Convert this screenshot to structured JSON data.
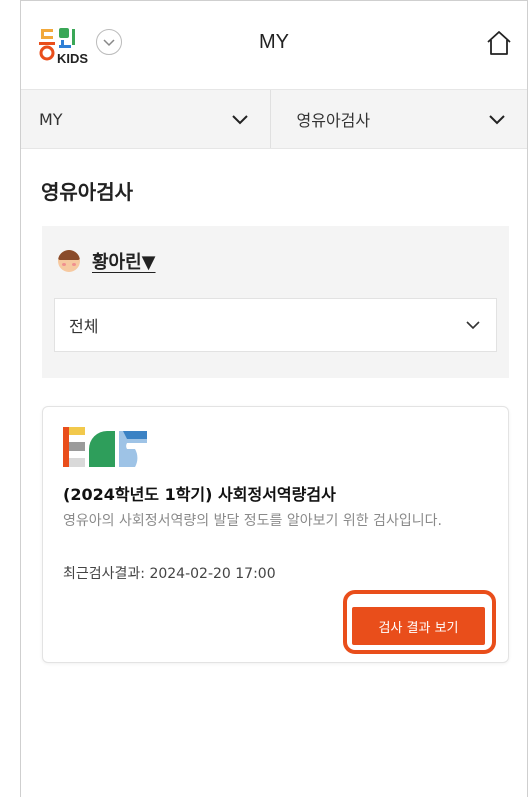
{
  "header": {
    "logo_text": "KIDS",
    "title": "MY"
  },
  "nav": {
    "left_label": "MY",
    "right_label": "영유아검사"
  },
  "page": {
    "title": "영유아검사"
  },
  "filter": {
    "child_name": "황아린▼",
    "select_value": "전체"
  },
  "card": {
    "title": "(2024학년도 1학기) 사회정서역량검사",
    "description": "영유아의 사회정서역량의 발달 정도를 알아보기 위한 검사입니다.",
    "last_result": "최근검사결과: 2024-02-20 17:00",
    "button_label": "검사 결과 보기"
  },
  "colors": {
    "accent": "#e94e1b",
    "nav_bg": "#f4f4f4"
  }
}
